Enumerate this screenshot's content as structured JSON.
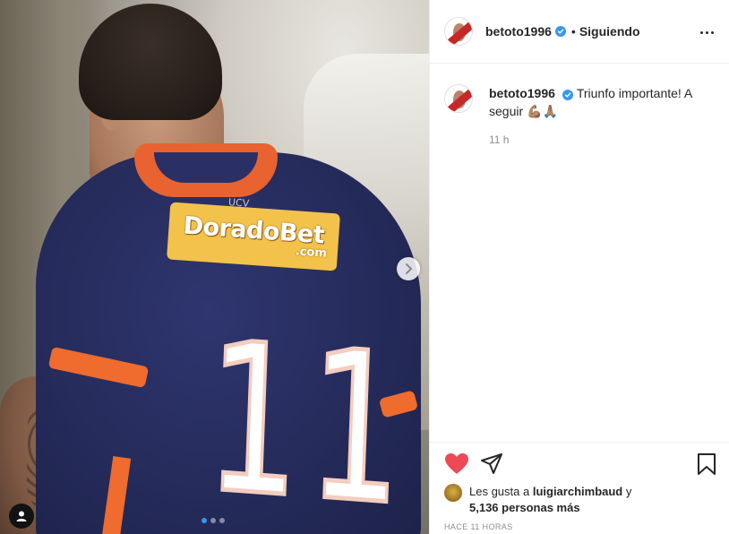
{
  "post": {
    "image_alt": "Jugador de espaldas con la camiseta número 11",
    "sponsor_text": "DoradoBet",
    "sponsor_domain": ".com",
    "crest_text": "UCV",
    "shirt_number": "11",
    "carousel": {
      "total_slides": 3,
      "active_slide": 1
    },
    "icons": {
      "next": "chevron-right-icon",
      "tag": "user-tag-icon"
    }
  },
  "header": {
    "username": "betoto1996",
    "verified": true,
    "separator": "•",
    "follow_status": "Siguiendo",
    "more_icon": "ellipsis-icon"
  },
  "caption": {
    "username": "betoto1996",
    "text": "Triunfo importante! A seguir 💪🏽🙏🏽",
    "time": "11 h"
  },
  "actions": {
    "liked": true,
    "like_icon": "heart-icon",
    "share_icon": "paper-plane-icon",
    "save_icon": "bookmark-icon"
  },
  "likes": {
    "prefix": "Les gusta a",
    "user": "luigiarchimbaud",
    "connector": "y",
    "others": "5,136 personas más"
  },
  "posted_ago": "HACE 11 HORAS",
  "colors": {
    "accent": "#3897f0",
    "like": "#ed4956",
    "text": "#262626",
    "muted": "#8e8e8e",
    "border": "#efefef"
  }
}
